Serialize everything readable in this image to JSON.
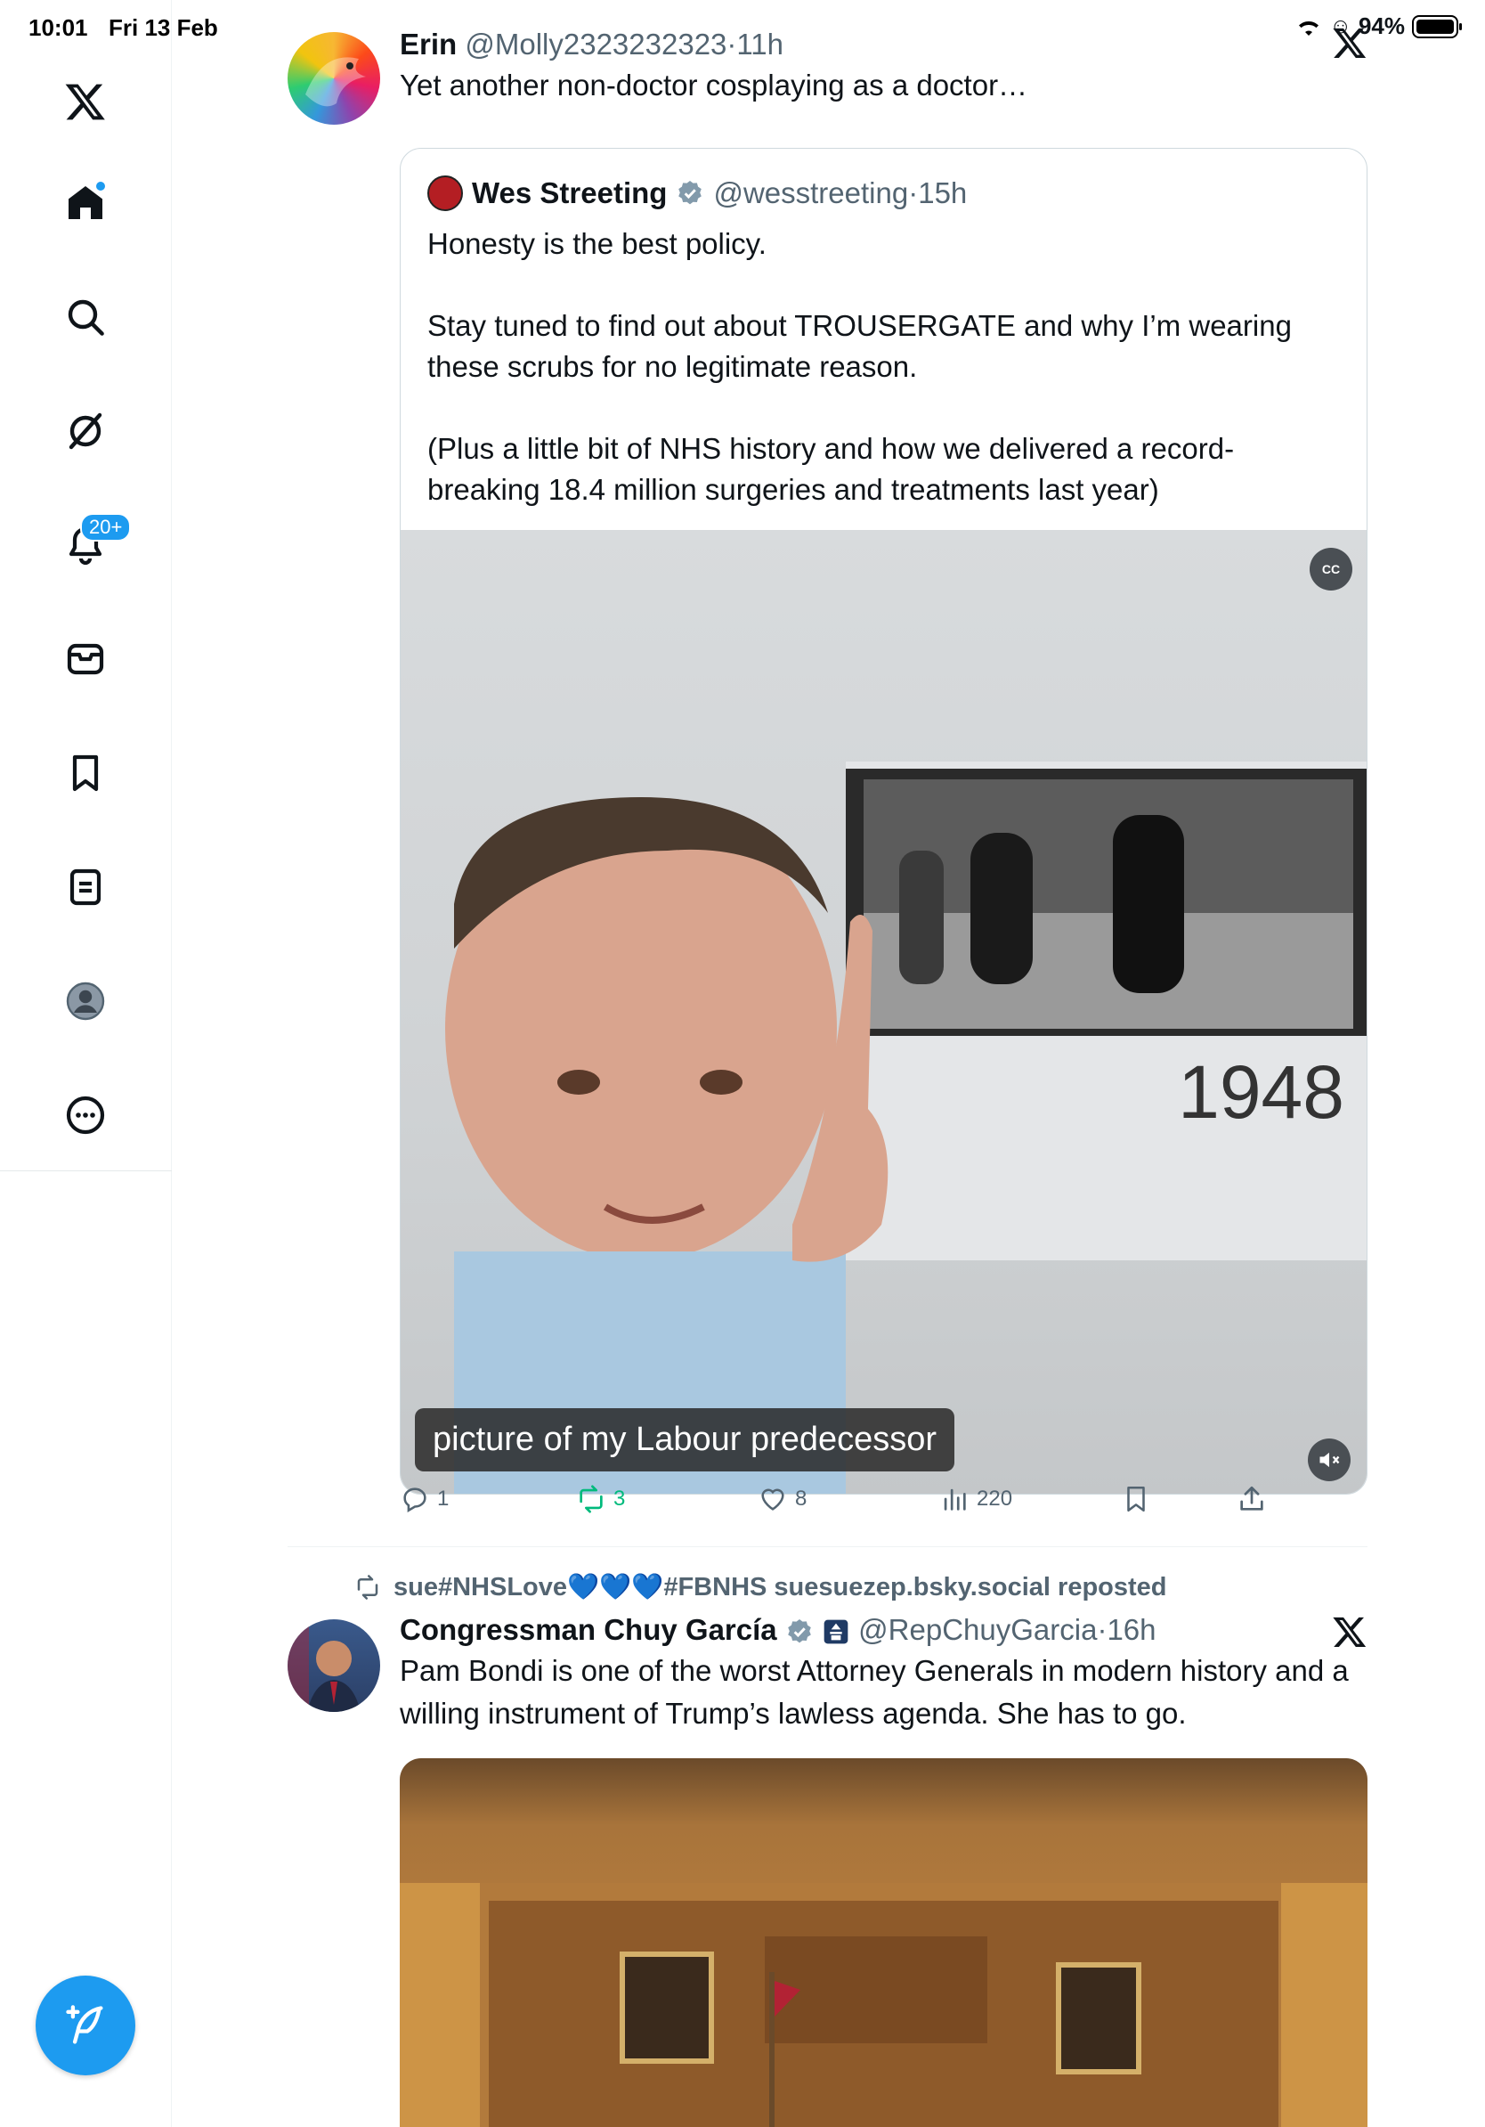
{
  "status_bar": {
    "time": "10:01",
    "date": "Fri 13 Feb",
    "battery": "94%"
  },
  "sidebar": {
    "items": [
      {
        "name": "x-logo"
      },
      {
        "name": "home",
        "has_dot": true
      },
      {
        "name": "search"
      },
      {
        "name": "grok"
      },
      {
        "name": "notifications",
        "badge": "20+"
      },
      {
        "name": "messages"
      },
      {
        "name": "bookmarks"
      },
      {
        "name": "lists"
      },
      {
        "name": "profile"
      },
      {
        "name": "more"
      }
    ],
    "compose_icon": "compose-icon"
  },
  "colors": {
    "accent": "#1d9bf0",
    "repost_green": "#00ba7c",
    "secondary_text": "#536471"
  },
  "posts": [
    {
      "author": "Erin",
      "handle": "@Molly2323232323",
      "sep": "·",
      "time": "11h",
      "text": "Yet another non-doctor cosplaying as a doctor…",
      "quote": {
        "author": "Wes Streeting",
        "handle": "@wesstreeting",
        "sep": "·",
        "time": "15h",
        "paragraphs": [
          "Honesty is the best policy.",
          "Stay tuned to find out about TROUSERGATE and why I’m wearing these scrubs for no legitimate reason.",
          "(Plus a little bit of NHS history and how we delivered a record-breaking 18.4 million surgeries and treatments last year)"
        ],
        "video": {
          "caption": "picture of my Labour predecessor",
          "cc_label": "CC",
          "year_text": "1948"
        }
      },
      "stats": {
        "replies": "1",
        "reposts": "3",
        "likes": "8",
        "views": "220"
      }
    },
    {
      "reposted_by": "sue#NHSLove💙💙💙#FBNHS suesuezep.bsky.social reposted",
      "author": "Congressman Chuy García",
      "handle": "@RepChuyGarcia",
      "sep": "·",
      "time": "16h",
      "text": "Pam Bondi is one of the worst Attorney Generals in modern history and a willing instrument of Trump’s lawless agenda. She has to go."
    }
  ]
}
